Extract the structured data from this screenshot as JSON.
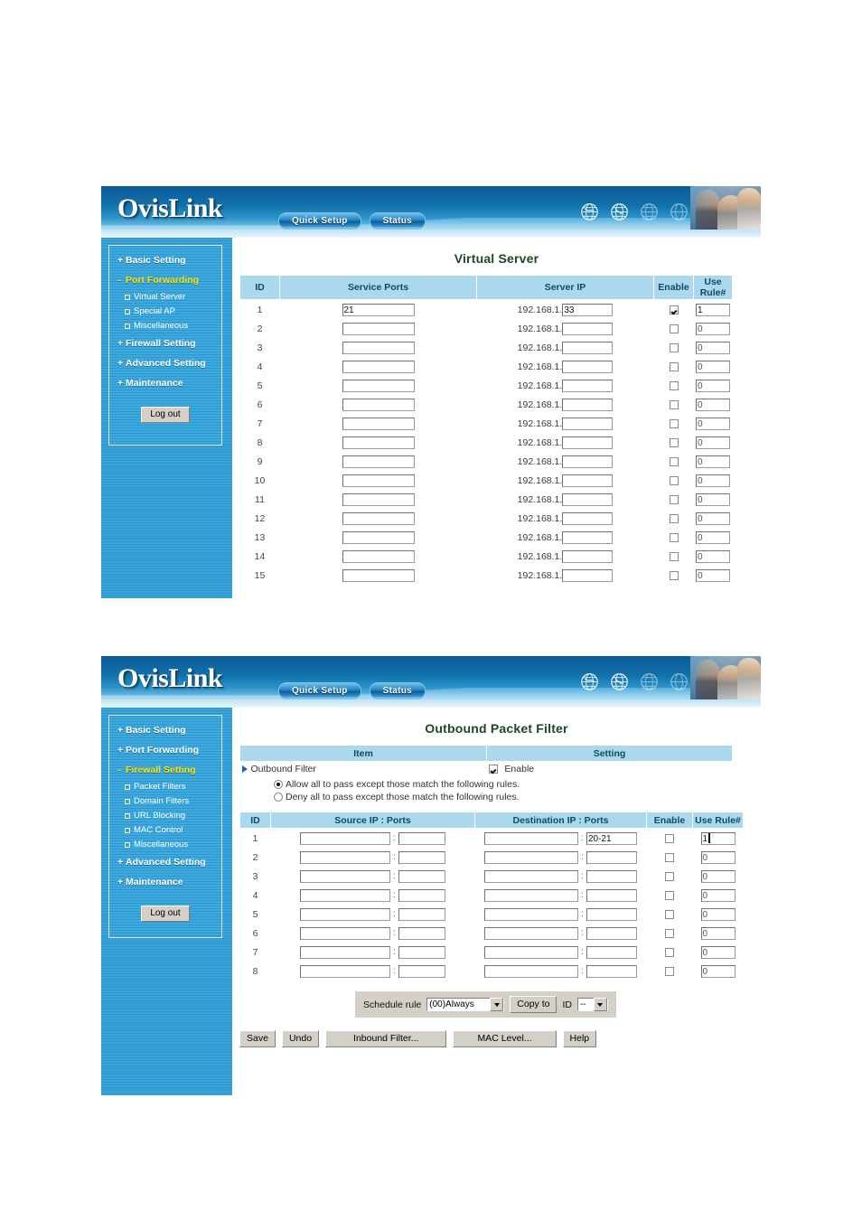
{
  "header": {
    "logo": "OvisLink",
    "quick_setup": "Quick Setup",
    "status": "Status",
    "colors": {
      "banner_dark": "#0a5a96",
      "banner_light": "#cfe9f6",
      "accent": "#abd8ec",
      "title_green": "#1e4723",
      "active_yellow": "#ffe400"
    }
  },
  "panel1": {
    "title": "Virtual Server",
    "sidebar": {
      "items": [
        {
          "marker": "+",
          "label": "Basic Setting",
          "active": false
        },
        {
          "marker": "-",
          "label": "Port Forwarding",
          "active": true
        },
        {
          "marker": "+",
          "label": "Firewall Setting",
          "active": false
        },
        {
          "marker": "+",
          "label": "Advanced Setting",
          "active": false
        },
        {
          "marker": "+",
          "label": "Maintenance",
          "active": false
        }
      ],
      "subitems": [
        "Virtual Server",
        "Special AP",
        "Miscellaneous"
      ],
      "logout": "Log out"
    },
    "columns": [
      "ID",
      "Service Ports",
      "Server IP",
      "Enable",
      "Use Rule#"
    ],
    "ip_prefix": "192.168.1.",
    "rows": [
      {
        "id": "1",
        "ports": "21",
        "ip": "33",
        "enable": true,
        "rule": "1"
      },
      {
        "id": "2",
        "ports": "",
        "ip": "",
        "enable": false,
        "rule": "0"
      },
      {
        "id": "3",
        "ports": "",
        "ip": "",
        "enable": false,
        "rule": "0"
      },
      {
        "id": "4",
        "ports": "",
        "ip": "",
        "enable": false,
        "rule": "0"
      },
      {
        "id": "5",
        "ports": "",
        "ip": "",
        "enable": false,
        "rule": "0"
      },
      {
        "id": "6",
        "ports": "",
        "ip": "",
        "enable": false,
        "rule": "0"
      },
      {
        "id": "7",
        "ports": "",
        "ip": "",
        "enable": false,
        "rule": "0"
      },
      {
        "id": "8",
        "ports": "",
        "ip": "",
        "enable": false,
        "rule": "0"
      },
      {
        "id": "9",
        "ports": "",
        "ip": "",
        "enable": false,
        "rule": "0"
      },
      {
        "id": "10",
        "ports": "",
        "ip": "",
        "enable": false,
        "rule": "0"
      },
      {
        "id": "11",
        "ports": "",
        "ip": "",
        "enable": false,
        "rule": "0"
      },
      {
        "id": "12",
        "ports": "",
        "ip": "",
        "enable": false,
        "rule": "0"
      },
      {
        "id": "13",
        "ports": "",
        "ip": "",
        "enable": false,
        "rule": "0"
      },
      {
        "id": "14",
        "ports": "",
        "ip": "",
        "enable": false,
        "rule": "0"
      },
      {
        "id": "15",
        "ports": "",
        "ip": "",
        "enable": false,
        "rule": "0"
      }
    ]
  },
  "panel2": {
    "title": "Outbound Packet Filter",
    "sidebar": {
      "items": [
        {
          "marker": "+",
          "label": "Basic Setting",
          "active": false
        },
        {
          "marker": "+",
          "label": "Port Forwarding",
          "active": false
        },
        {
          "marker": "-",
          "label": "Firewall Setting",
          "active": true
        },
        {
          "marker": "+",
          "label": "Advanced Setting",
          "active": false
        },
        {
          "marker": "+",
          "label": "Maintenance",
          "active": false
        }
      ],
      "subitems": [
        "Packet Filters",
        "Domain Filters",
        "URL Blocking",
        "MAC Control",
        "Miscellaneous"
      ],
      "logout": "Log out"
    },
    "setting_header": {
      "item": "Item",
      "setting": "Setting"
    },
    "outbound_filter_label": "Outbound Filter",
    "enable_label": "Enable",
    "enable_checked": true,
    "radio_allow": "Allow all to pass except those match the following rules.",
    "radio_deny": "Deny all to pass except those match the following rules.",
    "radio_selected": "allow",
    "columns": [
      "ID",
      "Source IP : Ports",
      "Destination IP : Ports",
      "Enable",
      "Use Rule#"
    ],
    "rows": [
      {
        "id": "1",
        "src_ip": "",
        "src_port": "",
        "dst_ip": "",
        "dst_port": "20-21",
        "enable": false,
        "rule": "1"
      },
      {
        "id": "2",
        "src_ip": "",
        "src_port": "",
        "dst_ip": "",
        "dst_port": "",
        "enable": false,
        "rule": "0"
      },
      {
        "id": "3",
        "src_ip": "",
        "src_port": "",
        "dst_ip": "",
        "dst_port": "",
        "enable": false,
        "rule": "0"
      },
      {
        "id": "4",
        "src_ip": "",
        "src_port": "",
        "dst_ip": "",
        "dst_port": "",
        "enable": false,
        "rule": "0"
      },
      {
        "id": "5",
        "src_ip": "",
        "src_port": "",
        "dst_ip": "",
        "dst_port": "",
        "enable": false,
        "rule": "0"
      },
      {
        "id": "6",
        "src_ip": "",
        "src_port": "",
        "dst_ip": "",
        "dst_port": "",
        "enable": false,
        "rule": "0"
      },
      {
        "id": "7",
        "src_ip": "",
        "src_port": "",
        "dst_ip": "",
        "dst_port": "",
        "enable": false,
        "rule": "0"
      },
      {
        "id": "8",
        "src_ip": "",
        "src_port": "",
        "dst_ip": "",
        "dst_port": "",
        "enable": false,
        "rule": "0"
      }
    ],
    "schedule": {
      "label": "Schedule rule",
      "value": "(00)Always",
      "copy_to": "Copy to",
      "id_label": "ID",
      "id_value": "--"
    },
    "buttons": [
      "Save",
      "Undo",
      "Inbound Filter...",
      "MAC Level...",
      "Help"
    ]
  }
}
